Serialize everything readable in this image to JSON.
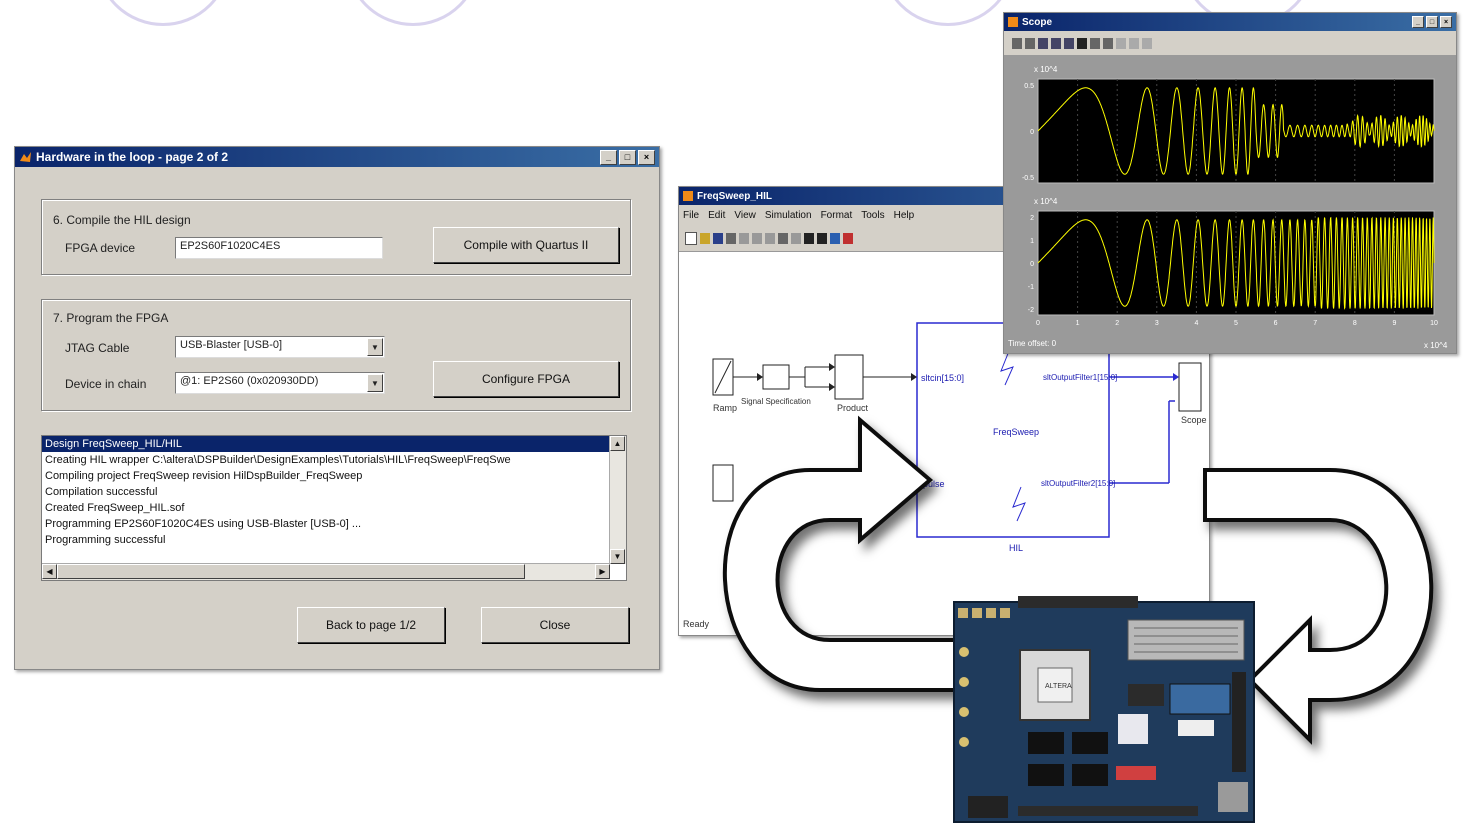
{
  "hil_dialog": {
    "title": "Hardware in the loop - page 2 of 2",
    "window_buttons": [
      "_",
      "□",
      "×"
    ],
    "compile": {
      "section_label": "6. Compile the HIL design",
      "fpga_device_label": "FPGA device",
      "fpga_device_value": "EP2S60F1020C4ES",
      "compile_button": "Compile with Quartus II"
    },
    "program": {
      "section_label": "7. Program the FPGA",
      "jtag_label": "JTAG Cable",
      "jtag_value": "USB-Blaster [USB-0]",
      "device_label": "Device in chain",
      "device_value": "@1: EP2S60 (0x020930DD)",
      "configure_button": "Configure FPGA"
    },
    "log_lines": [
      "Design FreqSweep_HIL/HIL",
      "Creating HIL wrapper C:\\altera\\DSPBuilder\\DesignExamples\\Tutorials\\HIL\\FreqSweep\\FreqSwe",
      "Compiling project FreqSweep revision HilDspBuilder_FreqSweep",
      "Compilation successful",
      "Created FreqSweep_HIL.sof",
      "Programming EP2S60F1020C4ES using USB-Blaster [USB-0] ...",
      "Programming successful"
    ],
    "back_button": "Back to page 1/2",
    "close_button": "Close"
  },
  "simulink_window": {
    "title": "FreqSweep_HIL",
    "menu": [
      "File",
      "Edit",
      "View",
      "Simulation",
      "Format",
      "Tools",
      "Help"
    ],
    "status": "Ready",
    "blocks": {
      "ramp": "Ramp",
      "signal_spec": "Signal Specification",
      "product": "Product",
      "hil_in": "sltcin[15:0]",
      "hil_center": "FreqSweep",
      "out_top": "sltOutputFilter1[15:0]",
      "out_bottom": "sltOutputFilter2[15:0]",
      "hil_bottom": "HIL",
      "scope": "Scope",
      "pulse": "pulse"
    }
  },
  "scope_window": {
    "title": "Scope",
    "top_exponent": "x 10^4",
    "bottom_exponent": "x 10^4",
    "top_ticks": [
      "0.5",
      "0",
      "-0.5"
    ],
    "bottom_ticks": [
      "2",
      "1",
      "0",
      "-1",
      "-2"
    ],
    "x_ticks": [
      "0",
      "1",
      "2",
      "3",
      "4",
      "5",
      "6",
      "7",
      "8",
      "9",
      "10"
    ],
    "time_offset": "Time offset:  0",
    "x_exponent": "x 10^4",
    "accent_color": "#ffff00"
  },
  "board": {
    "chip_label": "ALTERA",
    "color": "#1f3b5c"
  }
}
